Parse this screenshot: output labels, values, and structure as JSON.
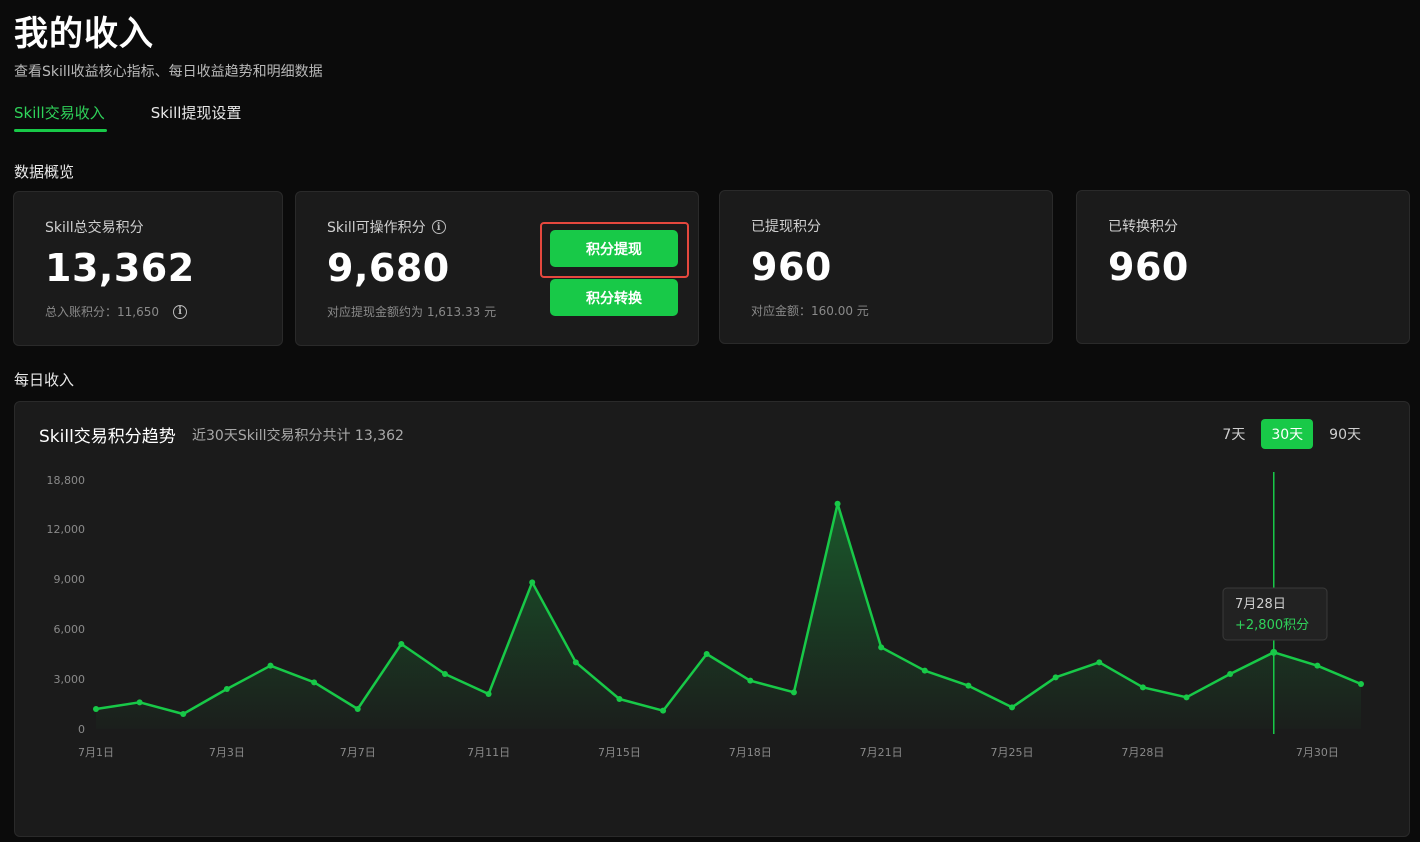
{
  "header": {
    "title": "我的收入",
    "subtitle": "查看Skill收益核心指标、每日收益趋势和明细数据"
  },
  "tabs": [
    {
      "label": "Skill交易收入",
      "active": true
    },
    {
      "label": "Skill提现设置",
      "active": false
    }
  ],
  "overview": {
    "section_label": "数据概览",
    "total": {
      "label": "Skill总交易积分",
      "value": "13,362",
      "note": "总入账积分：11,650"
    },
    "operable": {
      "label": "Skill可操作积分",
      "value": "9,680",
      "note": "对应提现金额约为 1,613.33 元",
      "withdraw_button": "积分提现",
      "convert_button": "积分转换"
    },
    "withdrawn": {
      "label": "已提现积分",
      "value": "960",
      "note": "对应金额：160.00 元"
    },
    "converted": {
      "label": "已转换积分",
      "value": "960"
    }
  },
  "daily": {
    "section_label": "每日收入",
    "chart_title": "Skill交易积分趋势",
    "chart_summary": "近30天Skill交易积分共计 13,362",
    "ranges": [
      "7天",
      "30天",
      "90天"
    ],
    "active_range": "30天",
    "tooltip": {
      "date": "7月28日",
      "value": "+2,800积分"
    }
  },
  "colors": {
    "accent": "#18c948",
    "highlight": "#e5483e",
    "background": "#0b0b0b",
    "card": "#1b1b1b"
  },
  "chart_data": {
    "type": "area",
    "y_ticks": [
      "18,800",
      "12,000",
      "9,000",
      "6,000",
      "3,000",
      "0"
    ],
    "x_ticks": [
      "7月1日",
      "7月3日",
      "7月7日",
      "7月11日",
      "7月15日",
      "7月18日",
      "7月21日",
      "7月25日",
      "7月28日",
      "7月30日"
    ],
    "series": [
      {
        "values": [
          1200,
          1600,
          900,
          2400,
          3800,
          2800,
          1200,
          5100,
          3300,
          2100,
          8800,
          4000,
          1800,
          1100,
          4500,
          2900,
          2200,
          15500,
          4900,
          3500,
          2600,
          1300,
          3100,
          4000,
          2500,
          1900,
          3300,
          4600,
          3800,
          2700
        ]
      }
    ],
    "highlight_index": 27,
    "grid": false
  }
}
